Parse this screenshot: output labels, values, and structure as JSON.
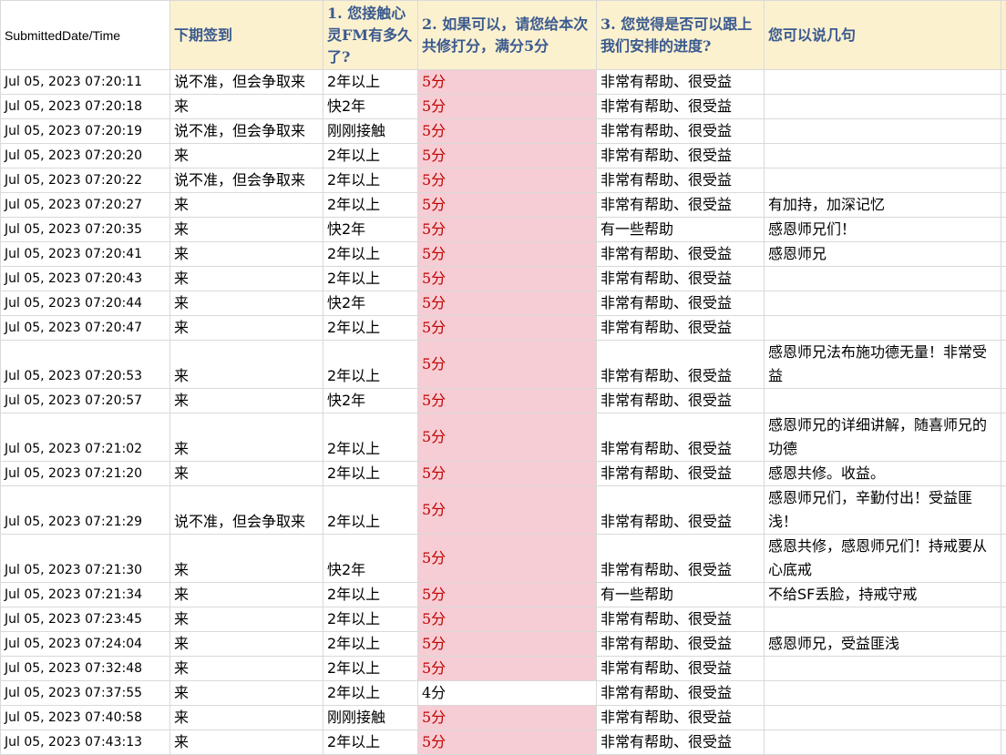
{
  "headers": [
    "SubmittedDate/Time",
    "下期签到",
    "1. 您接触心灵FM有多久了?",
    "2. 如果可以，请您给本次共修打分，满分5分",
    "3. 您觉得是否可以跟上我们安排的进度?",
    "您可以说几句",
    ""
  ],
  "rows": [
    {
      "date": "Jul 05, 2023 07:20:11",
      "signin": "说不准，但会争取来",
      "duration": "2年以上",
      "score": "5分",
      "progress": "非常有帮助、很受益",
      "comment": ""
    },
    {
      "date": "Jul 05, 2023 07:20:18",
      "signin": "来",
      "duration": "快2年",
      "score": "5分",
      "progress": "非常有帮助、很受益",
      "comment": ""
    },
    {
      "date": "Jul 05, 2023 07:20:19",
      "signin": "说不准，但会争取来",
      "duration": "刚刚接触",
      "score": "5分",
      "progress": "非常有帮助、很受益",
      "comment": ""
    },
    {
      "date": "Jul 05, 2023 07:20:20",
      "signin": "来",
      "duration": "2年以上",
      "score": "5分",
      "progress": "非常有帮助、很受益",
      "comment": ""
    },
    {
      "date": "Jul 05, 2023 07:20:22",
      "signin": "说不准，但会争取来",
      "duration": "2年以上",
      "score": "5分",
      "progress": "非常有帮助、很受益",
      "comment": ""
    },
    {
      "date": "Jul 05, 2023 07:20:27",
      "signin": "来",
      "duration": "2年以上",
      "score": "5分",
      "progress": "非常有帮助、很受益",
      "comment": "有加持，加深记忆"
    },
    {
      "date": "Jul 05, 2023 07:20:35",
      "signin": "来",
      "duration": "快2年",
      "score": "5分",
      "progress": "有一些帮助",
      "comment": "感恩师兄们！"
    },
    {
      "date": "Jul 05, 2023 07:20:41",
      "signin": "来",
      "duration": "2年以上",
      "score": "5分",
      "progress": "非常有帮助、很受益",
      "comment": "感恩师兄"
    },
    {
      "date": "Jul 05, 2023 07:20:43",
      "signin": "来",
      "duration": "2年以上",
      "score": "5分",
      "progress": "非常有帮助、很受益",
      "comment": ""
    },
    {
      "date": "Jul 05, 2023 07:20:44",
      "signin": "来",
      "duration": "快2年",
      "score": "5分",
      "progress": "非常有帮助、很受益",
      "comment": ""
    },
    {
      "date": "Jul 05, 2023 07:20:47",
      "signin": "来",
      "duration": "2年以上",
      "score": "5分",
      "progress": "非常有帮助、很受益",
      "comment": ""
    },
    {
      "date": "Jul 05, 2023 07:20:53",
      "signin": "来",
      "duration": "2年以上",
      "score": "5分",
      "progress": "非常有帮助、很受益",
      "comment": "感恩师兄法布施功德无量！非常受益",
      "tall": true
    },
    {
      "date": "Jul 05, 2023 07:20:57",
      "signin": "来",
      "duration": "快2年",
      "score": "5分",
      "progress": "非常有帮助、很受益",
      "comment": ""
    },
    {
      "date": "Jul 05, 2023 07:21:02",
      "signin": "来",
      "duration": "2年以上",
      "score": "5分",
      "progress": "非常有帮助、很受益",
      "comment": "感恩师兄的详细讲解，随喜师兄的功德",
      "tall": true
    },
    {
      "date": "Jul 05, 2023 07:21:20",
      "signin": "来",
      "duration": "2年以上",
      "score": "5分",
      "progress": "非常有帮助、很受益",
      "comment": "感恩共修。收益。"
    },
    {
      "date": "Jul 05, 2023 07:21:29",
      "signin": "说不准，但会争取来",
      "duration": "2年以上",
      "score": "5分",
      "progress": "非常有帮助、很受益",
      "comment": "感恩师兄们，辛勤付出！受益匪浅！",
      "tall": true
    },
    {
      "date": "Jul 05, 2023 07:21:30",
      "signin": "来",
      "duration": "快2年",
      "score": "5分",
      "progress": "非常有帮助、很受益",
      "comment": "感恩共修，感恩师兄们！持戒要从心底戒",
      "tall": true
    },
    {
      "date": "Jul 05, 2023 07:21:34",
      "signin": "来",
      "duration": "2年以上",
      "score": "5分",
      "progress": "有一些帮助",
      "comment": "不给SF丢脸，持戒守戒"
    },
    {
      "date": "Jul 05, 2023 07:23:45",
      "signin": "来",
      "duration": "2年以上",
      "score": "5分",
      "progress": "非常有帮助、很受益",
      "comment": ""
    },
    {
      "date": "Jul 05, 2023 07:24:04",
      "signin": "来",
      "duration": "2年以上",
      "score": "5分",
      "progress": "非常有帮助、很受益",
      "comment": "感恩师兄，受益匪浅"
    },
    {
      "date": "Jul 05, 2023 07:32:48",
      "signin": "来",
      "duration": "2年以上",
      "score": "5分",
      "progress": "非常有帮助、很受益",
      "comment": ""
    },
    {
      "date": "Jul 05, 2023 07:37:55",
      "signin": "来",
      "duration": "2年以上",
      "score": "4分",
      "progress": "非常有帮助、很受益",
      "comment": "",
      "plain": true
    },
    {
      "date": "Jul 05, 2023 07:40:58",
      "signin": "来",
      "duration": "刚刚接触",
      "score": "5分",
      "progress": "非常有帮助、很受益",
      "comment": ""
    },
    {
      "date": "Jul 05, 2023 07:43:13",
      "signin": "来",
      "duration": "2年以上",
      "score": "5分",
      "progress": "非常有帮助、很受益",
      "comment": ""
    }
  ]
}
